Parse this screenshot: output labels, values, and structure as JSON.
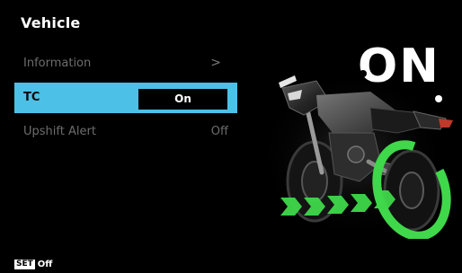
{
  "screen": {
    "title": "Vehicle"
  },
  "menu": {
    "items": [
      {
        "label": "Information",
        "value": "",
        "chevron": ">"
      },
      {
        "label": "TC",
        "value": "On"
      },
      {
        "label": "Upshift Alert",
        "value": "Off"
      }
    ],
    "selected_index": 1
  },
  "footer": {
    "set_badge": "SET",
    "state": "Off"
  },
  "illustration": {
    "status_text": "ON",
    "icon": "motorcycle-traction-control-icon"
  },
  "colors": {
    "background": "#000000",
    "selection": "#4cc0e6",
    "inactive_text": "#6d6d6d",
    "traction_green": "#3fd84a"
  }
}
